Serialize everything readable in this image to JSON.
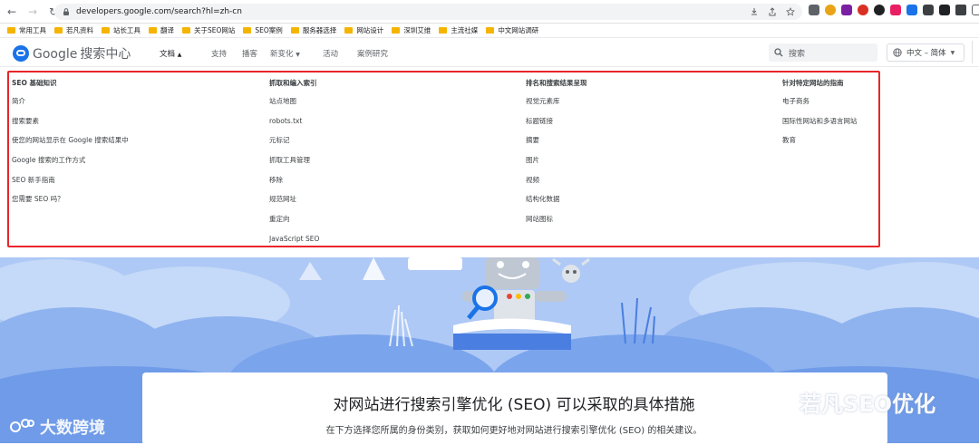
{
  "browser": {
    "url": "developers.google.com/search?hl=zh-cn"
  },
  "bookmarks": [
    "常用工具",
    "若凡资料",
    "站长工具",
    "翻译",
    "关于SEO网站",
    "SEO案例",
    "服务器选择",
    "网站设计",
    "深圳艾维",
    "主流社媒",
    "中文网站调研"
  ],
  "header": {
    "logo_google": "Google",
    "logo_product": "搜索中心",
    "nav": [
      "文档",
      "支持",
      "播客",
      "新变化",
      "活动",
      "案例研究"
    ],
    "search_placeholder": "搜索",
    "language": "中文 – 简体"
  },
  "menu": {
    "columns": [
      {
        "heading": "SEO 基础知识",
        "items": [
          "简介",
          "搜索要素",
          "使您的网站显示在 Google 搜索结果中",
          "Google 搜索的工作方式",
          "SEO 新手指南",
          "您需要 SEO 吗？"
        ]
      },
      {
        "heading": "抓取和编入索引",
        "items": [
          "站点地图",
          "robots.txt",
          "元标记",
          "抓取工具管理",
          "移除",
          "规范网址",
          "重定向",
          "JavaScript SEO"
        ]
      },
      {
        "heading": "排名和搜索结果呈现",
        "items": [
          "视觉元素库",
          "标题链接",
          "摘要",
          "图片",
          "视频",
          "结构化数据",
          "网站图标"
        ]
      },
      {
        "heading": "针对特定网站的指南",
        "items": [
          "电子商务",
          "国际性网站和多语言网站",
          "教育"
        ]
      }
    ]
  },
  "hero": {
    "title": "对网站进行搜索引擎优化 (SEO) 可以采取的具体措施",
    "subtitle": "在下方选择您所属的身份类别，获取如何更好地对网站进行搜索引擎优化 (SEO) 的相关建议。"
  },
  "watermarks": {
    "left": "大数跨境",
    "right": "若凡SEO优化"
  },
  "colors": {
    "highlight_border": "#e8262a",
    "hero_bg": "#aec9f5",
    "brand_blue": "#1a73e8"
  }
}
